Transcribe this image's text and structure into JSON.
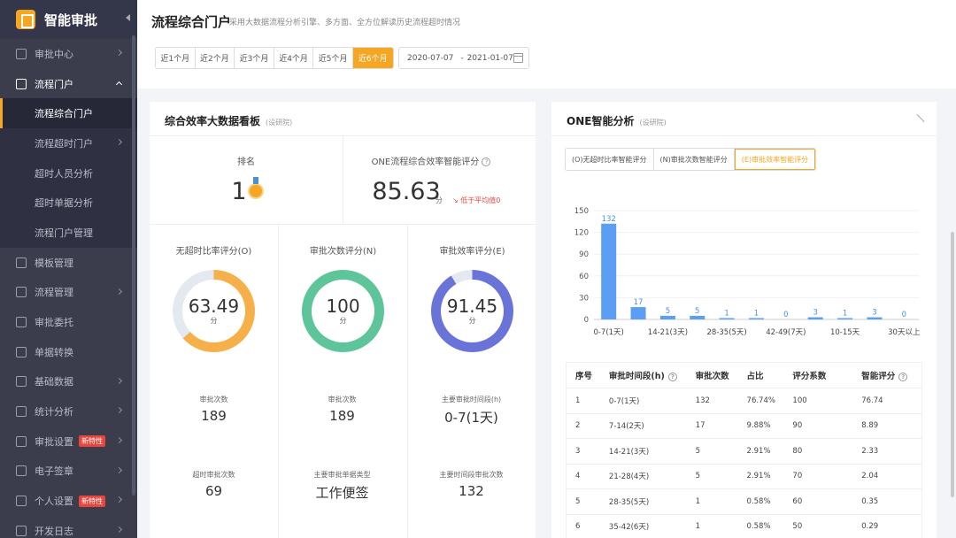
{
  "sidebar": {
    "app_name": "智能审批",
    "items": [
      {
        "label": "审批中心",
        "icon": "document-icon",
        "chevron": true
      },
      {
        "label": "流程门户",
        "icon": "chart-line-icon",
        "chevron": true,
        "open": true
      },
      {
        "label": "模板管理",
        "icon": "list-icon"
      },
      {
        "label": "流程管理",
        "icon": "org-icon",
        "chevron": true
      },
      {
        "label": "审批委托",
        "icon": "delegate-icon"
      },
      {
        "label": "单据转换",
        "icon": "convert-icon"
      },
      {
        "label": "基础数据",
        "icon": "database-icon",
        "chevron": true
      },
      {
        "label": "统计分析",
        "icon": "bar-chart-icon",
        "chevron": true
      },
      {
        "label": "审批设置",
        "icon": "gear-icon",
        "chevron": true,
        "badge": "新特性"
      },
      {
        "label": "电子签章",
        "icon": "seal-icon",
        "chevron": true
      },
      {
        "label": "个人设置",
        "icon": "user-icon",
        "chevron": true,
        "badge": "新特性"
      },
      {
        "label": "开发日志",
        "icon": "log-icon",
        "chevron": true
      }
    ],
    "sub_items": [
      {
        "label": "流程综合门户",
        "active": true
      },
      {
        "label": "流程超时门户",
        "chevron": true
      },
      {
        "label": "超时人员分析"
      },
      {
        "label": "超时单据分析"
      },
      {
        "label": "流程门户管理"
      }
    ]
  },
  "header": {
    "title": "流程综合门户",
    "subtitle": "采用大数据流程分析引擎、多方面、全方位解读历史流程超时情况",
    "ranges": [
      "近1个月",
      "近2个月",
      "近3个月",
      "近4个月",
      "近5个月",
      "近6个月"
    ],
    "active_range": 5,
    "date_start": "2020-07-07",
    "date_sep": "-",
    "date_end": "2021-01-07"
  },
  "left_card": {
    "title": "综合效率大数据看板",
    "hint": "(设研院)",
    "rank_label": "排名",
    "rank_value": "1",
    "score_label": "ONE流程综合效率智能评分",
    "score_value": "85.63",
    "score_unit": "分",
    "below_avg": "↘ 低于平均值0",
    "rings": [
      {
        "label": "无超时比率评分(O)",
        "value": "63.49",
        "unit": "分",
        "percent": 63.49,
        "color": "#f5b04a"
      },
      {
        "label": "审批次数评分(N)",
        "value": "100",
        "unit": "分",
        "percent": 100,
        "color": "#5ec49a"
      },
      {
        "label": "审批效率评分(E)",
        "value": "91.45",
        "unit": "分",
        "percent": 91.45,
        "color": "#6a74d8"
      }
    ],
    "stats_row1": [
      {
        "label": "审批次数",
        "value": "189"
      },
      {
        "label": "审批次数",
        "value": "189"
      },
      {
        "label": "主要审批时间段(h)",
        "value": "0-7(1天)"
      }
    ],
    "stats_row2": [
      {
        "label": "超时审批次数",
        "value": "69"
      },
      {
        "label": "主要审批单据类型",
        "value": "工作便签"
      },
      {
        "label": "主要时间段审批次数",
        "value": "132"
      }
    ]
  },
  "right_card": {
    "title": "ONE智能分析",
    "hint": "(设研院)",
    "tabs": [
      "(O)无超时比率智能评分",
      "(N)审批次数智能评分",
      "(E)审批效率智能评分"
    ],
    "active_tab": 2,
    "table": {
      "headers": [
        "序号",
        "审批时间段(h)",
        "审批次数",
        "占比",
        "评分系数",
        "智能评分"
      ],
      "rows": [
        [
          "1",
          "0-7(1天)",
          "132",
          "76.74%",
          "100",
          "76.74"
        ],
        [
          "2",
          "7-14(2天)",
          "17",
          "9.88%",
          "90",
          "8.89"
        ],
        [
          "3",
          "14-21(3天)",
          "5",
          "2.91%",
          "80",
          "2.33"
        ],
        [
          "4",
          "21-28(4天)",
          "5",
          "2.91%",
          "70",
          "2.04"
        ],
        [
          "5",
          "28-35(5天)",
          "1",
          "0.58%",
          "60",
          "0.35"
        ],
        [
          "6",
          "35-42(6天)",
          "1",
          "0.58%",
          "50",
          "0.29"
        ]
      ]
    }
  },
  "chart_data": {
    "type": "bar",
    "x_tick_labels": [
      "0-7(1天)",
      "14-21(3天)",
      "28-35(5天)",
      "42-49(7天)",
      "10-15天",
      "30天以上"
    ],
    "values": [
      132,
      17,
      5,
      5,
      1,
      1,
      0,
      3,
      1,
      3,
      0
    ],
    "ylim": [
      0,
      150
    ],
    "yticks": [
      0,
      30,
      60,
      90,
      120,
      150
    ],
    "color": "#5b9ef4",
    "grid": true
  }
}
